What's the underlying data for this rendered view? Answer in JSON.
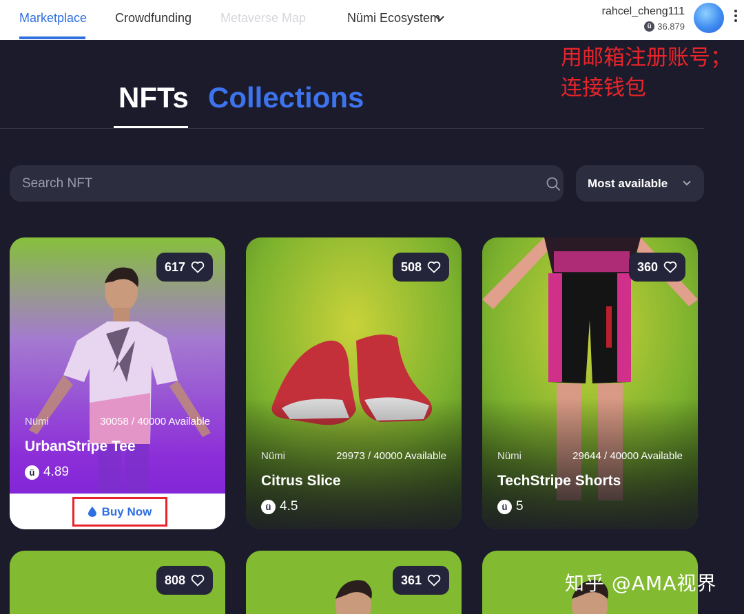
{
  "nav": {
    "tabs": [
      {
        "label": "Marketplace",
        "state": "active"
      },
      {
        "label": "Crowdfunding",
        "state": "normal"
      },
      {
        "label": "Metaverse Map",
        "state": "disabled"
      },
      {
        "label": "Nümi Ecosystem",
        "state": "dropdown"
      }
    ],
    "user": {
      "name": "rahcel_cheng111",
      "balance": "36.879",
      "coin_glyph": "ü"
    }
  },
  "annotation": {
    "line1": "用邮箱注册账号；",
    "line2": "连接钱包"
  },
  "watermark": "知乎 @AMA视界",
  "tabs": {
    "nfts": "NFTs",
    "collections": "Collections"
  },
  "search": {
    "placeholder": "Search NFT"
  },
  "sort": {
    "selected": "Most available"
  },
  "cards": [
    {
      "likes": "617",
      "brand": "Nümi",
      "availability": "30058 / 40000 Available",
      "name": "UrbanStripe Tee",
      "price": "4.89",
      "buy_label": "Buy Now"
    },
    {
      "likes": "508",
      "brand": "Nümi",
      "availability": "29973 / 40000 Available",
      "name": "Citrus Slice",
      "price": "4.5"
    },
    {
      "likes": "360",
      "brand": "Nümi",
      "availability": "29644 / 40000 Available",
      "name": "TechStripe Shorts",
      "price": "5"
    },
    {
      "likes": "808"
    },
    {
      "likes": "361"
    },
    {
      "likes": ""
    }
  ],
  "colors": {
    "accent": "#2f6fe0",
    "annotation": "#e8242a",
    "background": "#1b1b2c",
    "card_green": "#7bb52e"
  }
}
